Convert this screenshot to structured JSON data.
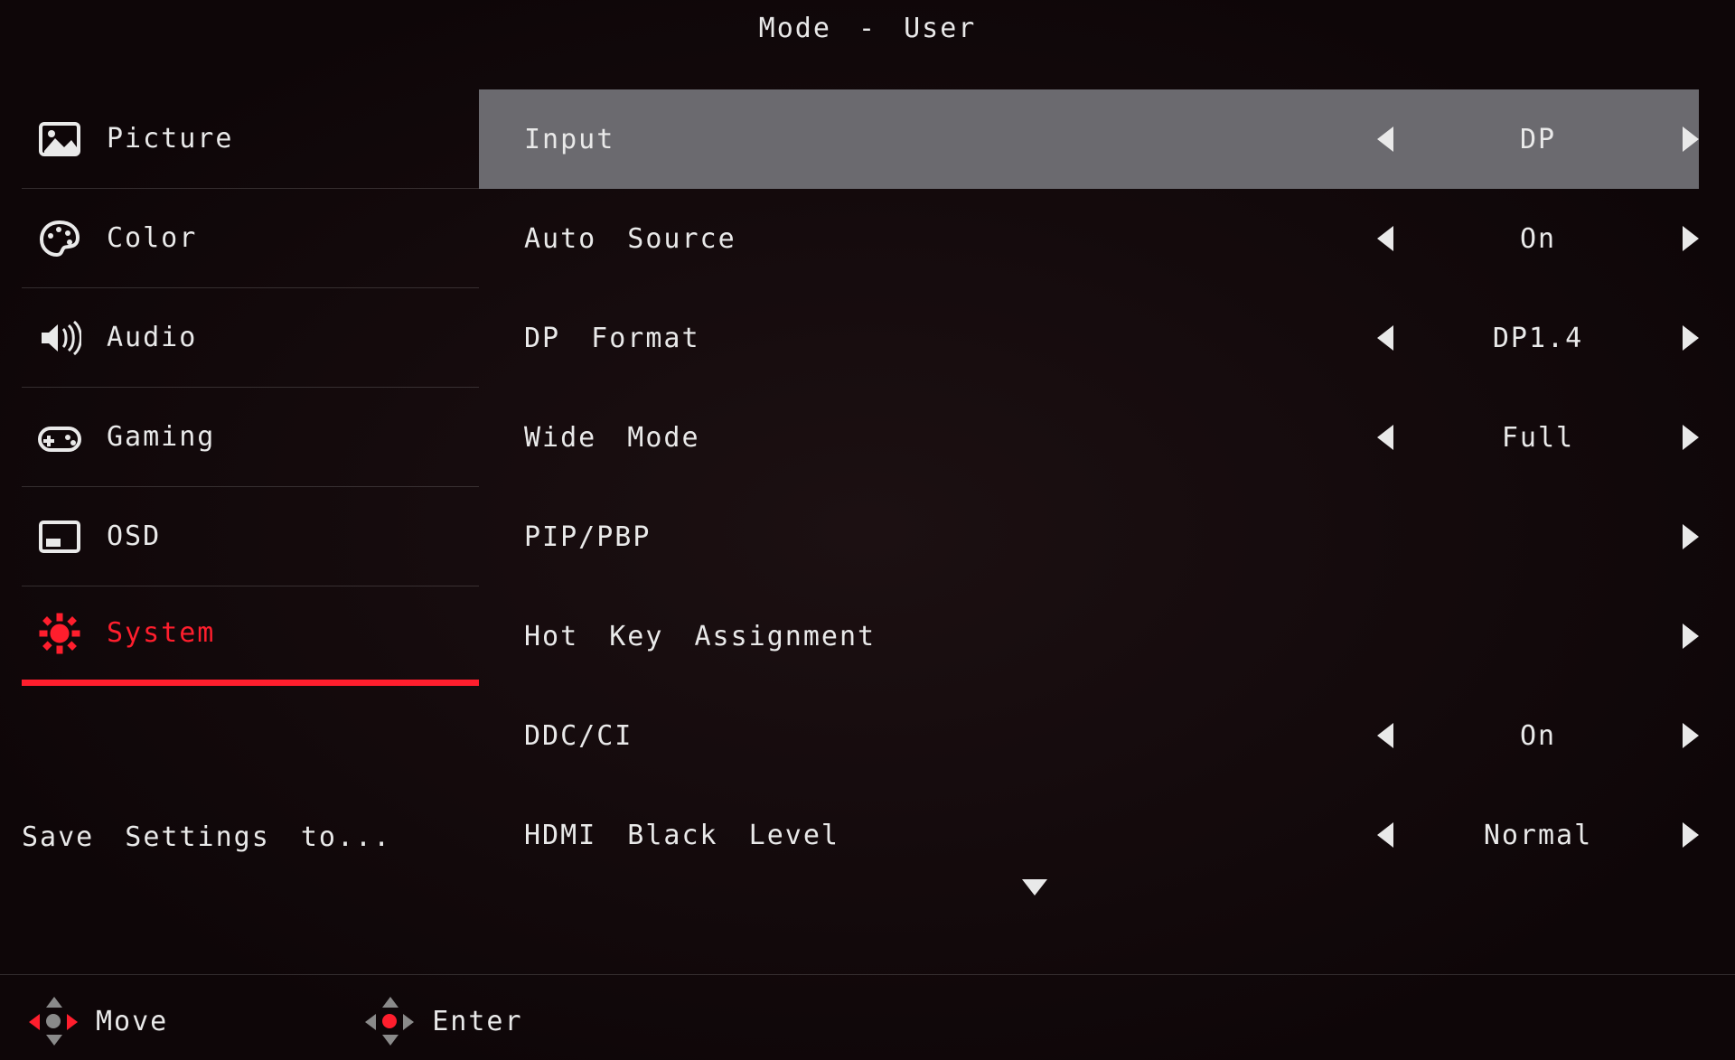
{
  "header": {
    "title": "Mode  -  User"
  },
  "sidebar": {
    "items": [
      {
        "label": "Picture"
      },
      {
        "label": "Color"
      },
      {
        "label": "Audio"
      },
      {
        "label": "Gaming"
      },
      {
        "label": "OSD"
      },
      {
        "label": "System"
      }
    ],
    "save_label": "Save  Settings  to..."
  },
  "settings": [
    {
      "label": "Input",
      "value": "DP",
      "has_left": true,
      "has_right": true,
      "highlight": true
    },
    {
      "label": "Auto  Source",
      "value": "On",
      "has_left": true,
      "has_right": true,
      "highlight": false
    },
    {
      "label": "DP  Format",
      "value": "DP1.4",
      "has_left": true,
      "has_right": true,
      "highlight": false
    },
    {
      "label": "Wide  Mode",
      "value": "Full",
      "has_left": true,
      "has_right": true,
      "highlight": false
    },
    {
      "label": "PIP/PBP",
      "value": "",
      "has_left": false,
      "has_right": true,
      "highlight": false
    },
    {
      "label": "Hot  Key  Assignment",
      "value": "",
      "has_left": false,
      "has_right": true,
      "highlight": false
    },
    {
      "label": "DDC/CI",
      "value": "On",
      "has_left": true,
      "has_right": true,
      "highlight": false
    },
    {
      "label": "HDMI  Black  Level",
      "value": "Normal",
      "has_left": true,
      "has_right": true,
      "highlight": false
    }
  ],
  "footer": {
    "move_label": "Move",
    "enter_label": "Enter"
  },
  "colors": {
    "accent": "#ff1e2d"
  }
}
